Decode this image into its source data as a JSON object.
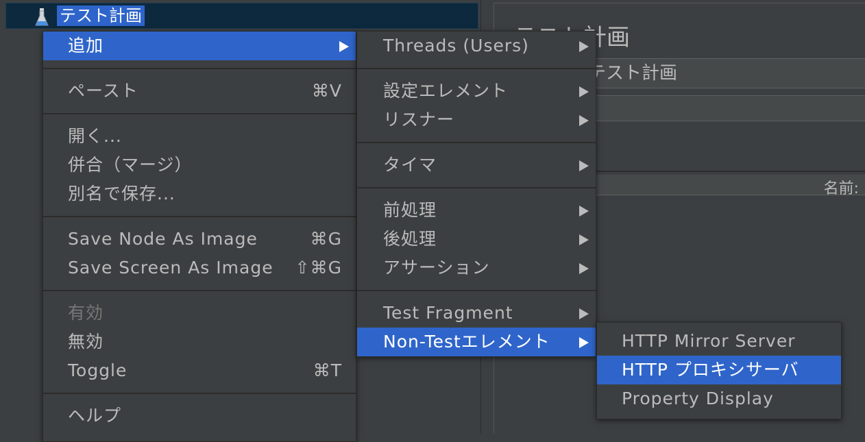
{
  "tree": {
    "root_label": "テスト計画",
    "root_icon": "test-plan-icon"
  },
  "panel": {
    "title": "テスト計画",
    "name_value": "テスト計画",
    "name_column_header": "名前:"
  },
  "context_menu": {
    "add": "追加",
    "paste": "ペースト",
    "paste_shortcut": "⌘V",
    "open": "開く...",
    "merge": "併合（マージ）",
    "save_as": "別名で保存...",
    "save_node_image": "Save Node As Image",
    "save_node_image_shortcut": "⌘G",
    "save_screen_image": "Save Screen As Image",
    "save_screen_image_shortcut": "⇧⌘G",
    "enable": "有効",
    "disable": "無効",
    "toggle": "Toggle",
    "toggle_shortcut": "⌘T",
    "help": "ヘルプ"
  },
  "add_submenu": {
    "threads": "Threads (Users)",
    "config_element": "設定エレメント",
    "listener": "リスナー",
    "timer": "タイマ",
    "pre_processor": "前処理",
    "post_processor": "後処理",
    "assertion": "アサーション",
    "test_fragment": "Test Fragment",
    "non_test_element": "Non-Testエレメント"
  },
  "non_test_submenu": {
    "http_mirror": "HTTP Mirror Server",
    "http_proxy": "HTTP プロキシサーバ",
    "property_display": "Property Display"
  },
  "colors": {
    "selection": "#2f65ca",
    "menu_bg": "#3c3f41",
    "text": "#bbbbbb"
  }
}
